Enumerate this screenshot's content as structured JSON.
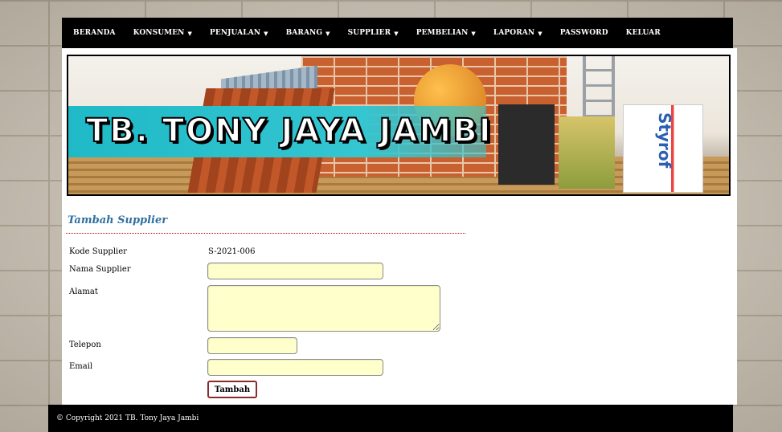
{
  "nav": {
    "items": [
      {
        "label": "BERANDA",
        "dropdown": false
      },
      {
        "label": "KONSUMEN",
        "dropdown": true
      },
      {
        "label": "PENJUALAN",
        "dropdown": true
      },
      {
        "label": "BARANG",
        "dropdown": true
      },
      {
        "label": "SUPPLIER",
        "dropdown": true
      },
      {
        "label": "PEMBELIAN",
        "dropdown": true
      },
      {
        "label": "LAPORAN",
        "dropdown": true
      },
      {
        "label": "PASSWORD",
        "dropdown": false
      },
      {
        "label": "KELUAR",
        "dropdown": false
      }
    ],
    "dropdown_icon": "chevron-down-icon"
  },
  "banner": {
    "store_name": "TB. TONY JAYA JAMBI",
    "styro_text": "Styrof"
  },
  "form": {
    "title": "Tambah Supplier",
    "kode_label": "Kode Supplier",
    "kode_value": "S-2021-006",
    "nama_label": "Nama Supplier",
    "nama_value": "",
    "alamat_label": "Alamat",
    "alamat_value": "",
    "telepon_label": "Telepon",
    "telepon_value": "",
    "email_label": "Email",
    "email_value": "",
    "submit_label": "Tambah"
  },
  "footer": {
    "copyright": "© Copyright 2021 TB. Tony Jaya Jambi"
  },
  "colors": {
    "navbar": "#000000",
    "title": "#2f6f9f",
    "input_bg": "#ffffcc",
    "button_border": "#8b2b2b",
    "teal": "#1fb9c7"
  }
}
